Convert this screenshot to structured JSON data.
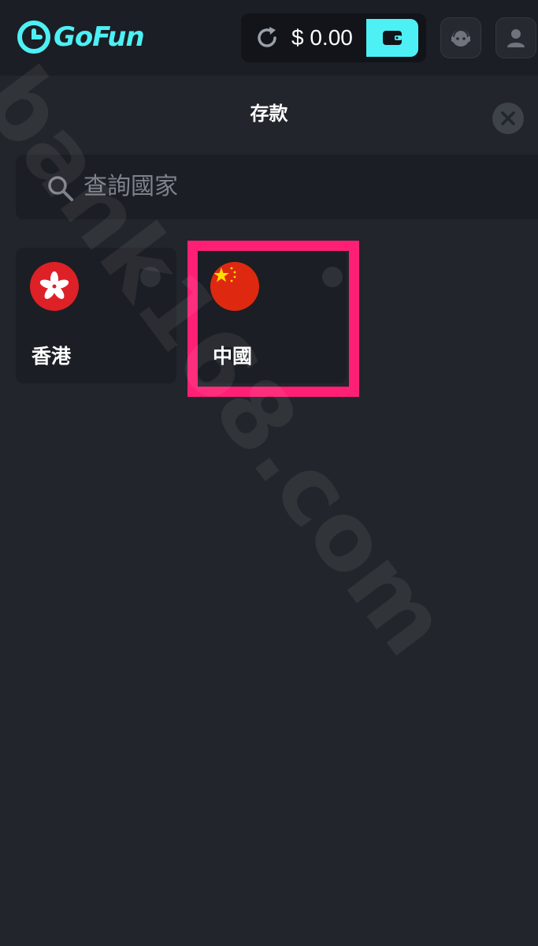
{
  "header": {
    "brand_name": "GoFun",
    "balance": "$ 0.00",
    "icons": {
      "logo": "gofun-logo-icon",
      "refresh": "refresh-icon",
      "wallet": "wallet-icon",
      "support": "customer-service-icon",
      "profile": "user-icon"
    },
    "accent_color": "#4df0f4"
  },
  "modal": {
    "title": "存款",
    "close_icon": "close-icon",
    "search": {
      "placeholder": "查詢國家",
      "value": "",
      "icon": "search-icon"
    },
    "countries": [
      {
        "name": "香港",
        "flag_icon": "hong-kong-flag-icon",
        "selected": false
      },
      {
        "name": "中國",
        "flag_icon": "china-flag-icon",
        "selected": false
      }
    ]
  },
  "annotation": {
    "highlight_color": "#ff1f74"
  },
  "watermark": "bank168.com"
}
